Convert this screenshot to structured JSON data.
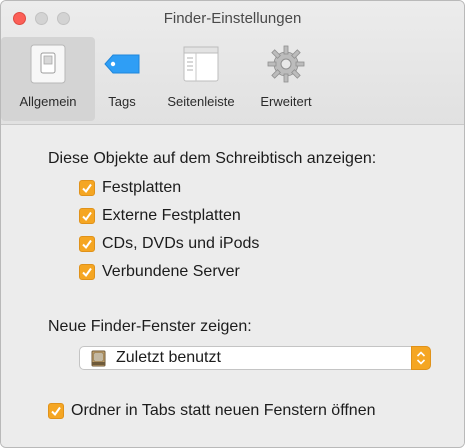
{
  "window": {
    "title": "Finder-Einstellungen"
  },
  "toolbar": {
    "tabs": [
      {
        "label": "Allgemein",
        "icon": "switch-icon",
        "active": true
      },
      {
        "label": "Tags",
        "icon": "tag-icon",
        "active": false
      },
      {
        "label": "Seitenleiste",
        "icon": "sidebar-icon",
        "active": false
      },
      {
        "label": "Erweitert",
        "icon": "gear-icon",
        "active": false
      }
    ]
  },
  "desktop_section": {
    "heading": "Diese Objekte auf dem Schreibtisch anzeigen:",
    "items": [
      {
        "label": "Festplatten",
        "checked": true
      },
      {
        "label": "Externe Festplatten",
        "checked": true
      },
      {
        "label": "CDs, DVDs und iPods",
        "checked": true
      },
      {
        "label": "Verbundene Server",
        "checked": true
      }
    ]
  },
  "new_window": {
    "label": "Neue Finder-Fenster zeigen:",
    "selected": "Zuletzt benutzt",
    "icon": "ledger-icon"
  },
  "tabs_option": {
    "label": "Ordner in Tabs statt neuen Fenstern öffnen",
    "checked": true
  },
  "colors": {
    "accent": "#f5a623",
    "close": "#fc5f57",
    "tag_blue": "#2f9ef5"
  }
}
